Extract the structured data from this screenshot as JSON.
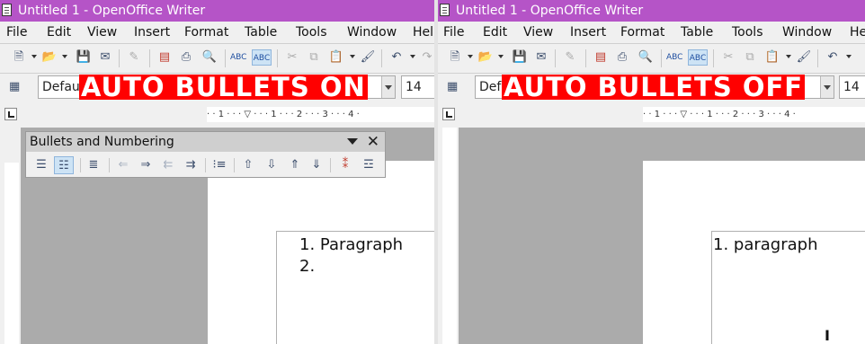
{
  "left": {
    "window_title": "Untitled 1 - OpenOffice Writer",
    "menus": [
      "File",
      "Edit",
      "View",
      "Insert",
      "Format",
      "Table",
      "Tools",
      "Window",
      "Hel"
    ],
    "style_combo": "Defau",
    "font_combo": "...",
    "font_size": "14",
    "banner": "AUTO BULLETS ON",
    "ruler_text": "· · 1 · · · ▽ · · · 1 · · · 2 · · · 3 · · · 4 ·",
    "bullets_toolbar": {
      "title": "Bullets and Numbering",
      "icons": [
        "bullets-off-icon",
        "numbering-on-icon",
        "paragraph-align-icon",
        "demote-icon",
        "promote-icon",
        "demote-with-subpoints-icon",
        "promote-with-subpoints-icon",
        "insert-unnumbered-entry-icon",
        "move-up-icon",
        "move-down-icon",
        "move-up-with-subpoints-icon",
        "move-down-with-subpoints-icon",
        "restart-numbering-icon",
        "bullets-numbering-dialog-icon"
      ]
    },
    "doc_lines": [
      "1. Paragraph",
      "2."
    ]
  },
  "right": {
    "window_title": "Untitled 1 - OpenOffice Writer",
    "menus": [
      "File",
      "Edit",
      "View",
      "Insert",
      "Format",
      "Table",
      "Tools",
      "Window",
      "He"
    ],
    "style_combo": "Defaul",
    "font_combo": "...",
    "font_size": "14",
    "banner": "AUTO BULLETS OFF",
    "ruler_text": "· · 1 · · · ▽ · · · 1 · · · 2 · · · 3 · · · 4 ·",
    "doc_lines": [
      "1. paragraph"
    ]
  },
  "colors": {
    "titlebar": "#b554c7",
    "banner_bg": "#ff0000",
    "doc_background": "#ababab"
  }
}
